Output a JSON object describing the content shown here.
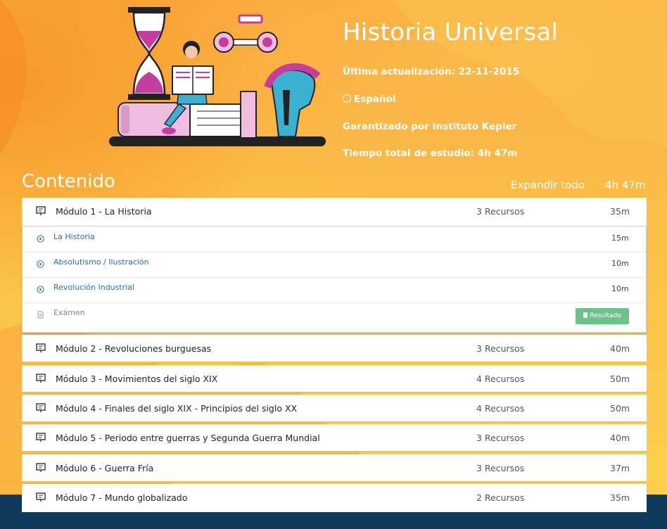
{
  "course": {
    "title": "Historia Universal",
    "updated": "Última actualización: 22-11-2015",
    "language": "Español",
    "guarantee": "Garantizado por Instituto Kepler",
    "study_time": "Tiempo total de estudio: 4h 47m"
  },
  "contents": {
    "heading": "Contenido",
    "expand_all": "Expandir todo",
    "total": "4h 47m"
  },
  "modules": [
    {
      "label": "Módulo 1 - La Historia",
      "resources": "3 Recursos",
      "duration": "35m"
    },
    {
      "label": "Módulo 2 - Revoluciones burguesas",
      "resources": "3 Recursos",
      "duration": "40m"
    },
    {
      "label": "Módulo 3 - Movimientos del siglo XIX",
      "resources": "4 Recursos",
      "duration": "50m"
    },
    {
      "label": "Módulo 4 - Finales del siglo XIX - Principios del siglo XX",
      "resources": "4 Recursos",
      "duration": "50m"
    },
    {
      "label": "Módulo 5 - Periodo entre guerras y Segunda Guerra Mundial",
      "resources": "3 Recursos",
      "duration": "40m"
    },
    {
      "label": "Módulo 6 - Guerra Fría",
      "resources": "3 Recursos",
      "duration": "37m"
    },
    {
      "label": "Módulo 7 - Mundo globalizado",
      "resources": "2 Recursos",
      "duration": "35m"
    }
  ],
  "module1_items": [
    {
      "label": "La Historia",
      "duration": "15m",
      "icon": "play-circle-icon"
    },
    {
      "label": "Absolutismo / Ilustración",
      "duration": "10m",
      "icon": "play-circle-icon"
    },
    {
      "label": "Revolución Industrial",
      "duration": "10m",
      "icon": "play-circle-icon"
    },
    {
      "label": "Exámen",
      "button": "Resultado",
      "icon": "document-icon"
    }
  ],
  "colors": {
    "accent_orange": "#f9a63a",
    "accent_yellow": "#fdd04c",
    "footer_navy": "#0d3a5c",
    "link_blue": "#2a6ea6",
    "result_green": "#6cc38a"
  }
}
